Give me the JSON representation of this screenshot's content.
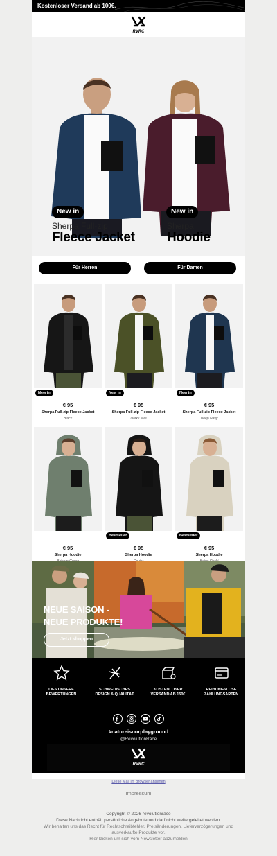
{
  "topbar": {
    "text": "Kostenloser Versand ab 100€."
  },
  "hero": {
    "left": {
      "tag": "New in",
      "subtitle": "Sherpa Full-zip",
      "title": "Fleece Jacket"
    },
    "right": {
      "tag": "New in",
      "subtitle": "Sherpa",
      "title": "Hoodie"
    }
  },
  "buttons": {
    "men": "Für Herren",
    "women": "Für Damen"
  },
  "products": [
    {
      "badge": "New in",
      "price": "€ 95",
      "name": "Sherpa Full-zip Fleece Jacket",
      "color": "Black",
      "swatch": "#161616",
      "pants": "#4a5336",
      "skin": "#c79b7c",
      "hair": "#4a3223",
      "female": false
    },
    {
      "badge": "New in",
      "price": "€ 95",
      "name": "Sherpa Full-zip Fleece Jacket",
      "color": "Dark Olive",
      "swatch": "#4b5127",
      "pants": "#1c1c20",
      "skin": "#c79b7c",
      "hair": "#4a3223",
      "female": false
    },
    {
      "badge": "New in",
      "price": "€ 95",
      "name": "Sherpa Full-zip Fleece Jacket",
      "color": "Deep Navy",
      "swatch": "#1f3650",
      "pants": "#1c1c20",
      "skin": "#c79b7c",
      "hair": "#4a3223",
      "female": false
    },
    {
      "badge": "",
      "price": "€ 95",
      "name": "Sherpa Hoodie",
      "color": "Balsam Green",
      "swatch": "#6f7f6e",
      "pants": "#1c1c1c",
      "skin": "#d8b093",
      "hair": "#5a3d2b",
      "female": true
    },
    {
      "badge": "Bestseller",
      "price": "€ 95",
      "name": "Sherpa Hoodie",
      "color": "Caviar",
      "swatch": "#151515",
      "pants": "#4a5336",
      "skin": "#d8b093",
      "hair": "#2a1d16",
      "female": true
    },
    {
      "badge": "Bestseller",
      "price": "€ 95",
      "name": "Sherpa Hoodie",
      "color": "Beige Khaki",
      "swatch": "#d9d2c0",
      "pants": "#1c1c1c",
      "skin": "#d8b093",
      "hair": "#8a5a36",
      "female": true
    }
  ],
  "banner": {
    "line1": "NEUE SAISON -",
    "line2": "NEUE PRODUKTE!",
    "cta": "Jetzt shoppen"
  },
  "features": [
    {
      "icon": "star-icon",
      "line1": "LIES UNSERE",
      "line2": "BEWERTUNGEN"
    },
    {
      "icon": "swedish-design-icon",
      "line1": "SCHWEDISCHES",
      "line2": "DESIGN & QUALITÄT"
    },
    {
      "icon": "shipping-box-icon",
      "line1": "KOSTENLOSER",
      "line2": "VERSAND AB 150€"
    },
    {
      "icon": "credit-card-icon",
      "line1": "REIBUNGSLOSE",
      "line2": "ZAHLUNGSARTEN"
    }
  ],
  "social": {
    "hashtag": "#natureisourplayground",
    "handle": "@RevolutionRace"
  },
  "brand": {
    "logo_text": "RVRC"
  },
  "footer_links": {
    "browser": "Diese Mail im Browser ansehen",
    "imprint": "Impressum",
    "copyright": "Copyright © 2026 revolutionrace",
    "personal": "Diese Nachricht enthält persönliche Angebote und darf nicht weitergeleitet werden.",
    "rights1": "Wir behalten uns das Recht für Rechtschreibfehler, Preisänderungen, Lieferverzögerungen und",
    "rights2": "ausverkaufte Produkte vor.",
    "unsubscribe": "Hier klicken um sich vom Newsletter abzumelden"
  },
  "colors": {
    "accent": "#000000",
    "hero_bg": "#f2f2f2",
    "page_bg": "#eeeeed",
    "jacket_navy": "#1f3a5a",
    "hoodie_plum": "#4a1c2c"
  }
}
